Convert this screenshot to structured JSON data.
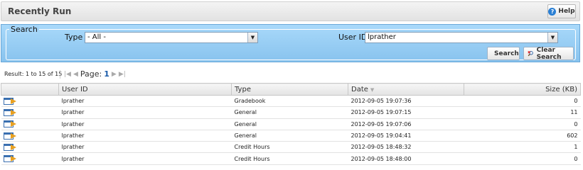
{
  "header": {
    "title": "Recently Run",
    "help_label": "Help"
  },
  "search": {
    "legend": "Search",
    "type_label": "Type",
    "type_value": "- All -",
    "user_label": "User ID",
    "user_value": "lprather",
    "search_button": "Search",
    "clear_button": "Clear Search"
  },
  "results": {
    "summary": "Result: 1 to 15 of 15",
    "page_label": "Page:",
    "page_number": "1"
  },
  "table": {
    "columns": [
      "",
      "User ID",
      "Type",
      "Date",
      "Size (KB)"
    ],
    "rows": [
      {
        "user": "lprather",
        "type": "Gradebook",
        "date": "2012-09-05 19:07:36",
        "size": "0"
      },
      {
        "user": "lprather",
        "type": "General",
        "date": "2012-09-05 19:07:15",
        "size": "11"
      },
      {
        "user": "lprather",
        "type": "General",
        "date": "2012-09-05 19:07:06",
        "size": "0"
      },
      {
        "user": "lprather",
        "type": "General",
        "date": "2012-09-05 19:04:41",
        "size": "602"
      },
      {
        "user": "lprather",
        "type": "Credit Hours",
        "date": "2012-09-05 18:48:32",
        "size": "1"
      },
      {
        "user": "lprather",
        "type": "Credit Hours",
        "date": "2012-09-05 18:48:00",
        "size": "0"
      }
    ]
  },
  "icons": {
    "help": "help-question-icon",
    "search": "magnifier-icon",
    "clear": "clear-search-icon",
    "run": "run-report-icon"
  }
}
